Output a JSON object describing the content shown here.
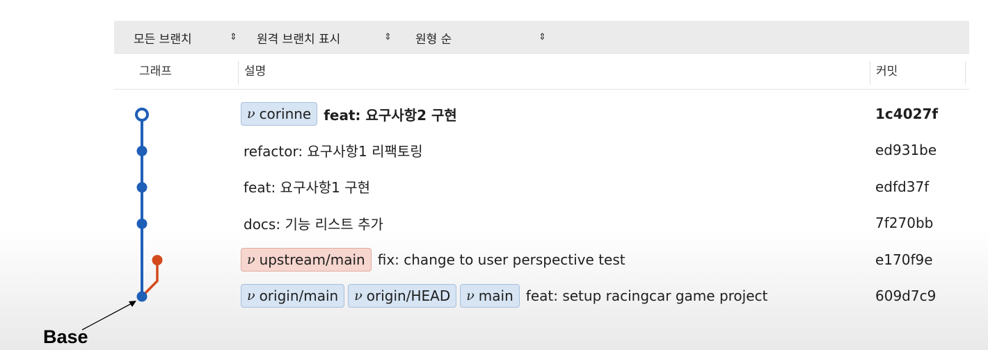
{
  "toolbar": {
    "branch_filter": "모든 브랜치",
    "remote_filter": "원격 브랜치 표시",
    "order_filter": "원형 순",
    "chevron_glyph": "⌃⌄"
  },
  "columns": {
    "graph": "그래프",
    "description": "설명",
    "commit": "커밋"
  },
  "commits": [
    {
      "badges": [
        {
          "name": "corinne",
          "kind": "local"
        }
      ],
      "message": "feat: 요구사항2 구현",
      "hash": "1c4027f",
      "bold": true,
      "lane": "main",
      "node": "hollow"
    },
    {
      "badges": [],
      "message": "refactor: 요구사항1 리팩토링",
      "hash": "ed931be",
      "bold": false,
      "lane": "main",
      "node": "filled"
    },
    {
      "badges": [],
      "message": "feat: 요구사항1 구현",
      "hash": "edfd37f",
      "bold": false,
      "lane": "main",
      "node": "filled"
    },
    {
      "badges": [],
      "message": "docs: 기능 리스트 추가",
      "hash": "7f270bb",
      "bold": false,
      "lane": "main",
      "node": "filled"
    },
    {
      "badges": [
        {
          "name": "upstream/main",
          "kind": "upstream"
        }
      ],
      "message": "fix: change to user perspective test",
      "hash": "e170f9e",
      "bold": false,
      "lane": "branch",
      "node": "filled"
    },
    {
      "badges": [
        {
          "name": "origin/main",
          "kind": "remote"
        },
        {
          "name": "origin/HEAD",
          "kind": "remote"
        },
        {
          "name": "main",
          "kind": "local"
        }
      ],
      "message": "feat: setup racingcar game project",
      "hash": "609d7c9",
      "bold": false,
      "lane": "main",
      "node": "filled"
    }
  ],
  "graph_colors": {
    "main": "#1f5fb8",
    "branch": "#d24a1c"
  },
  "annotation": {
    "label": "Base"
  },
  "icons": {
    "branch_badge": "branch-icon",
    "sort": "chevron-updown-icon"
  }
}
